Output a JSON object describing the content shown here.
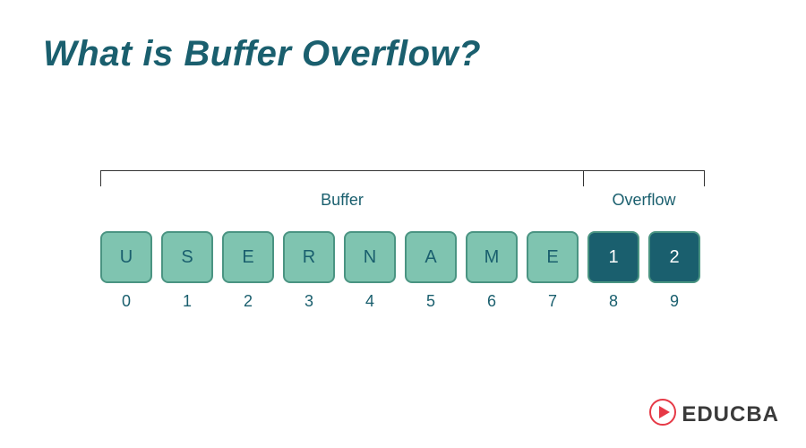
{
  "title": "What is Buffer Overflow?",
  "sections": {
    "buffer_label": "Buffer",
    "overflow_label": "Overflow"
  },
  "cells": [
    {
      "char": "U",
      "index": "0",
      "kind": "buf"
    },
    {
      "char": "S",
      "index": "1",
      "kind": "buf"
    },
    {
      "char": "E",
      "index": "2",
      "kind": "buf"
    },
    {
      "char": "R",
      "index": "3",
      "kind": "buf"
    },
    {
      "char": "N",
      "index": "4",
      "kind": "buf"
    },
    {
      "char": "A",
      "index": "5",
      "kind": "buf"
    },
    {
      "char": "M",
      "index": "6",
      "kind": "buf"
    },
    {
      "char": "E",
      "index": "7",
      "kind": "buf"
    },
    {
      "char": "1",
      "index": "8",
      "kind": "ovf"
    },
    {
      "char": "2",
      "index": "9",
      "kind": "ovf"
    }
  ],
  "logo": {
    "text": "EDUCBA"
  },
  "colors": {
    "title": "#1a5f6e",
    "buffer_cell_bg": "#7fc4b0",
    "overflow_cell_bg": "#1a5f6e",
    "cell_border": "#4a9482",
    "logo_accent": "#e63946"
  }
}
